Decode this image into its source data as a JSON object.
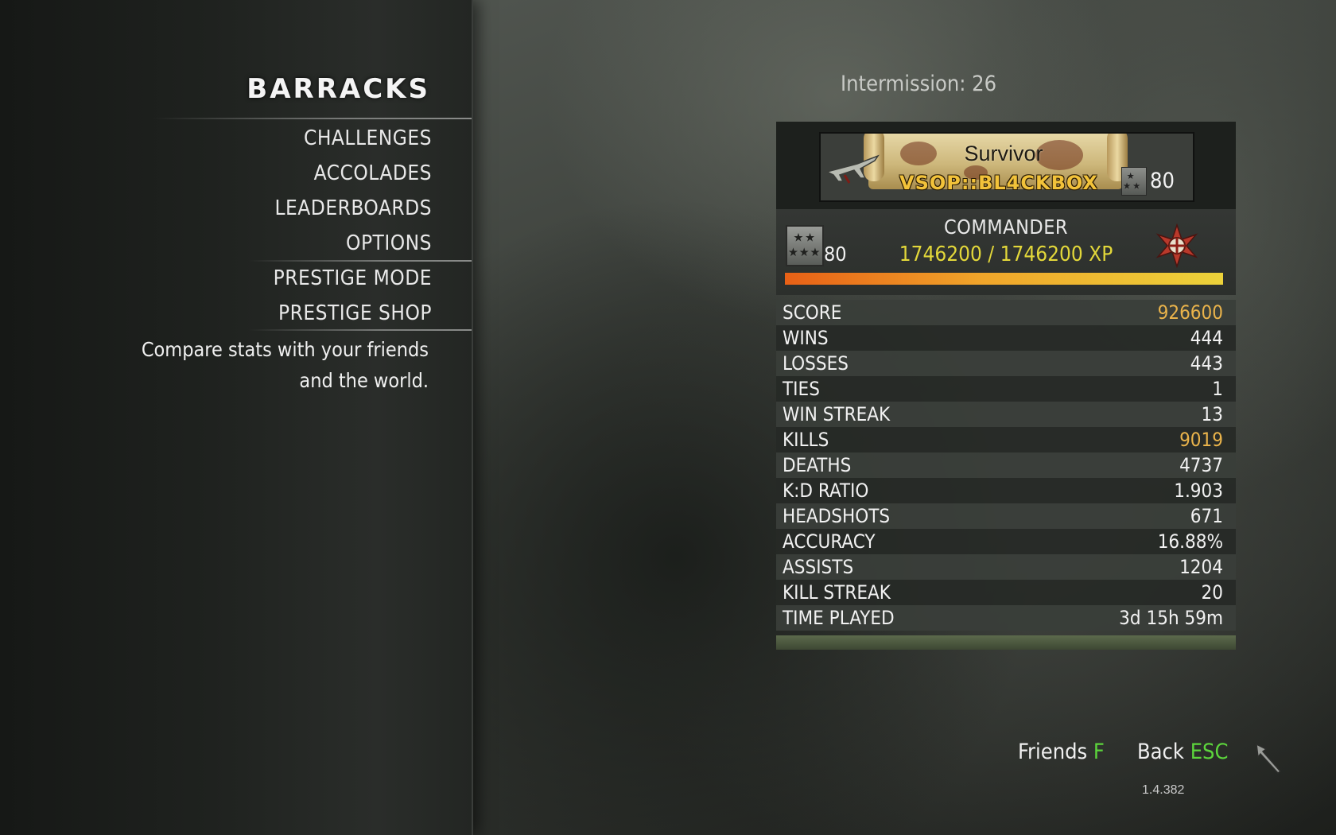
{
  "menu": {
    "title": "BARRACKS",
    "items": [
      {
        "label": "CHALLENGES"
      },
      {
        "label": "ACCOLADES"
      },
      {
        "label": "LEADERBOARDS"
      },
      {
        "label": "OPTIONS"
      },
      {
        "label": "PRESTIGE MODE"
      },
      {
        "label": "PRESTIGE SHOP"
      }
    ],
    "description_lines": [
      "Compare stats with your friends",
      "and the world."
    ]
  },
  "header": {
    "intermission_label": "Intermission:",
    "intermission_value": "26"
  },
  "player": {
    "callsign_title": "Survivor",
    "gamertag": "VSOP::BL4CKBOX",
    "callsign_level": "80",
    "rank_name": "COMMANDER",
    "rank_level": "80",
    "xp_current": "1746200",
    "xp_separator": " / ",
    "xp_max": "1746200 XP",
    "xp_progress": 1.0,
    "rank_icon": "commander-rank-icon",
    "prestige_icon": "prestige-emblem-icon"
  },
  "stats": [
    {
      "label": "SCORE",
      "value": "926600",
      "highlight": true
    },
    {
      "label": "WINS",
      "value": "444",
      "highlight": false
    },
    {
      "label": "LOSSES",
      "value": "443",
      "highlight": false
    },
    {
      "label": "TIES",
      "value": "1",
      "highlight": false
    },
    {
      "label": "WIN STREAK",
      "value": "13",
      "highlight": false
    },
    {
      "label": "KILLS",
      "value": "9019",
      "highlight": true
    },
    {
      "label": "DEATHS",
      "value": "4737",
      "highlight": false
    },
    {
      "label": "K:D RATIO",
      "value": "1.903",
      "highlight": false
    },
    {
      "label": "HEADSHOTS",
      "value": "671",
      "highlight": false
    },
    {
      "label": "ACCURACY",
      "value": "16.88%",
      "highlight": false
    },
    {
      "label": "ASSISTS",
      "value": "1204",
      "highlight": false
    },
    {
      "label": "KILL STREAK",
      "value": "20",
      "highlight": false
    },
    {
      "label": "TIME PLAYED",
      "value": "3d 15h 59m",
      "highlight": false
    }
  ],
  "prompts": {
    "friends_label": "Friends",
    "friends_key": "F",
    "back_label": "Back",
    "back_key": "ESC"
  },
  "version": "1.4.382",
  "colors": {
    "highlight": "#e9b34b",
    "key": "#5cd43c",
    "xp_text": "#e2d73a",
    "gamertag": "#f2c23a"
  }
}
